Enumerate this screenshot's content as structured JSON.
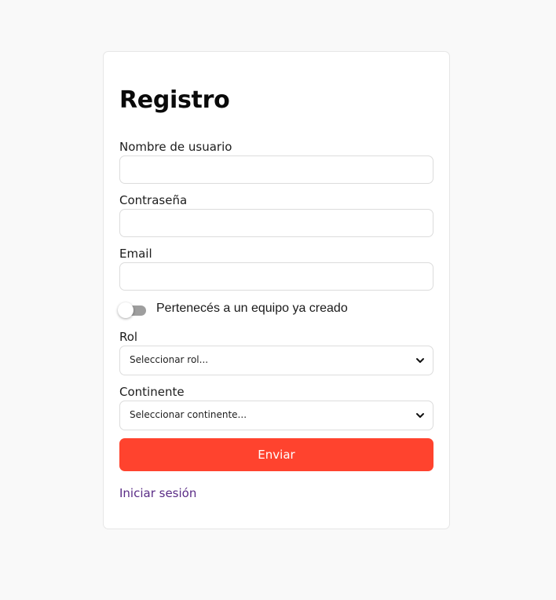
{
  "form": {
    "title": "Registro",
    "username_label": "Nombre de usuario",
    "username_value": "",
    "password_label": "Contraseña",
    "password_value": "",
    "email_label": "Email",
    "email_value": "",
    "team_toggle_label": "Pertenecés a un equipo ya creado",
    "team_toggle_on": false,
    "role_label": "Rol",
    "role_selected": "Seleccionar rol...",
    "continent_label": "Continente",
    "continent_selected": "Seleccionar continente...",
    "submit_label": "Enviar",
    "login_link": "Iniciar sesión"
  },
  "colors": {
    "page_background": "#f9f9f9",
    "card_background": "#ffffff",
    "submit_background": "#ff432e",
    "submit_text": "#ffffff",
    "link": "#5a2c86",
    "toggle_track_off": "#9e9e9e"
  },
  "icons": {
    "select_arrow": "chevron-down-icon"
  }
}
